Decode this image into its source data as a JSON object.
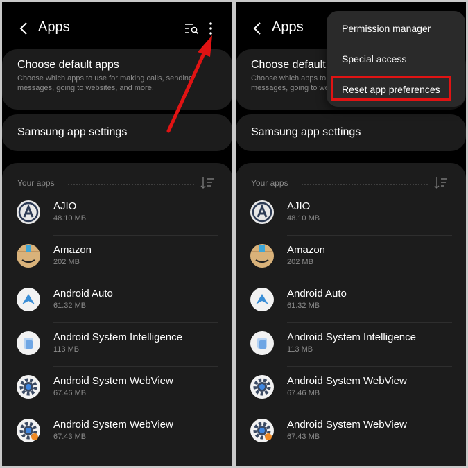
{
  "screens": [
    {
      "header": {
        "title": "Apps"
      },
      "defaults_card": {
        "title": "Choose default apps",
        "subtitle": "Choose which apps to use for making calls, sending messages, going to websites, and more."
      },
      "samsung_card": {
        "title": "Samsung app settings"
      },
      "apps_section": {
        "label": "Your apps",
        "apps": [
          {
            "name": "AJIO",
            "size": "48.10 MB",
            "icon": "ajio-icon"
          },
          {
            "name": "Amazon",
            "size": "202 MB",
            "icon": "amazon-icon"
          },
          {
            "name": "Android Auto",
            "size": "61.32 MB",
            "icon": "android-auto-icon"
          },
          {
            "name": "Android System Intelligence",
            "size": "113 MB",
            "icon": "asi-icon"
          },
          {
            "name": "Android System WebView",
            "size": "67.46 MB",
            "icon": "gear-icon"
          },
          {
            "name": "Android System WebView",
            "size": "67.43 MB",
            "icon": "gear-icon"
          }
        ]
      }
    },
    {
      "header": {
        "title": "Apps"
      },
      "defaults_card": {
        "title": "Choose default apps",
        "subtitle": "Choose which apps to use for making calls, sending messages, going to websites, and more."
      },
      "samsung_card": {
        "title": "Samsung app settings"
      },
      "apps_section": {
        "label": "Your apps",
        "apps": [
          {
            "name": "AJIO",
            "size": "48.10 MB",
            "icon": "ajio-icon"
          },
          {
            "name": "Amazon",
            "size": "202 MB",
            "icon": "amazon-icon"
          },
          {
            "name": "Android Auto",
            "size": "61.32 MB",
            "icon": "android-auto-icon"
          },
          {
            "name": "Android System Intelligence",
            "size": "113 MB",
            "icon": "asi-icon"
          },
          {
            "name": "Android System WebView",
            "size": "67.46 MB",
            "icon": "gear-icon"
          },
          {
            "name": "Android System WebView",
            "size": "67.43 MB",
            "icon": "gear-icon"
          }
        ]
      },
      "overflow_menu": {
        "items": [
          "Permission manager",
          "Special access",
          "Reset app preferences"
        ]
      }
    }
  ],
  "colors": {
    "highlight": "#e01313",
    "background": "#000000",
    "card": "#1c1c1c",
    "menu": "#2a2a2a"
  }
}
